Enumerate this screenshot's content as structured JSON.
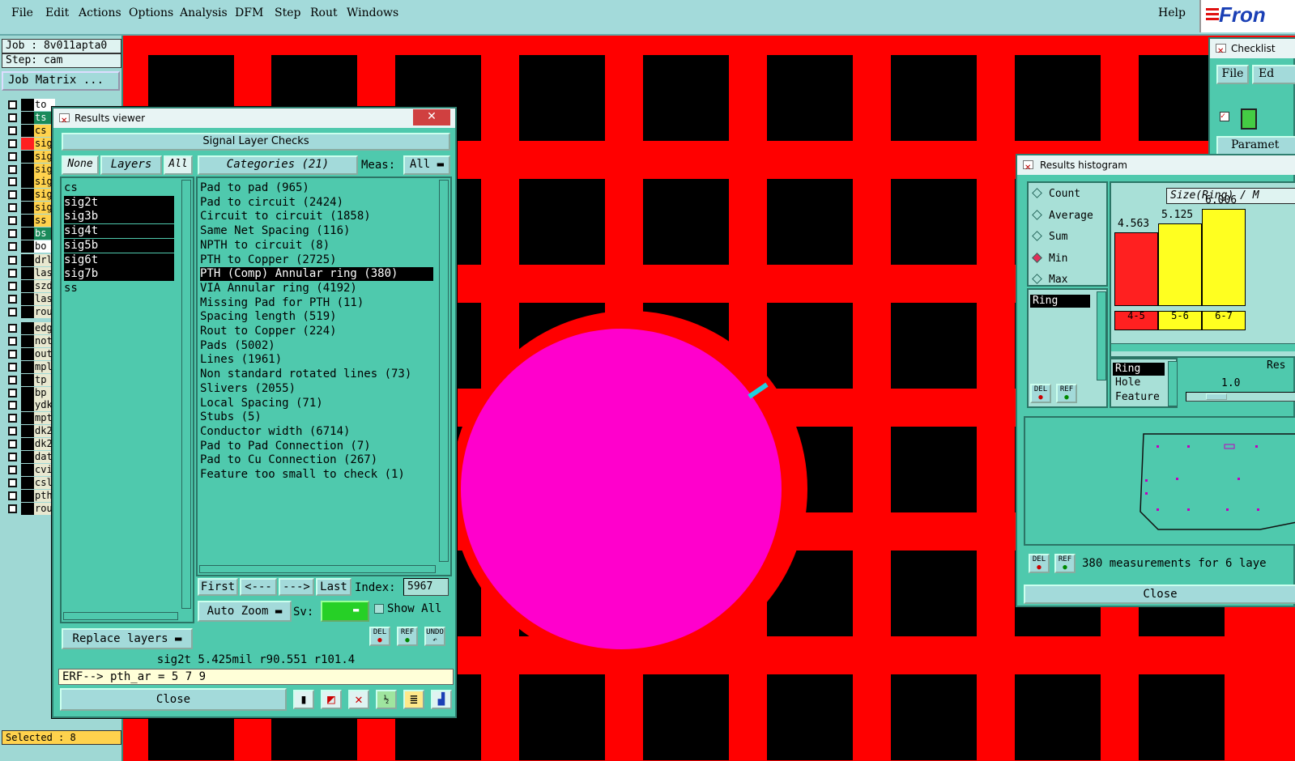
{
  "menubar": {
    "items": [
      "File",
      "Edit",
      "Actions",
      "Options",
      "Analysis",
      "DFM",
      "Step",
      "Rout",
      "Windows"
    ],
    "help": "Help",
    "logo": "Fron"
  },
  "left_panel": {
    "job": "Job : 8v011apta0",
    "step": "Step: cam",
    "job_matrix": "Job Matrix ...",
    "layers": [
      {
        "name": "to",
        "color": "#ffffff"
      },
      {
        "name": "ts",
        "color": "#1a8a5a"
      },
      {
        "name": "cs",
        "color": "#ffd24d"
      },
      {
        "name": "sig",
        "color": "#ffd24d"
      },
      {
        "name": "sig",
        "color": "#ffd24d"
      },
      {
        "name": "sig",
        "color": "#ffd24d"
      },
      {
        "name": "sig",
        "color": "#ffd24d"
      },
      {
        "name": "sig",
        "color": "#ffd24d"
      },
      {
        "name": "sig",
        "color": "#ffd24d"
      },
      {
        "name": "ss",
        "color": "#ffd24d"
      },
      {
        "name": "bs",
        "color": "#1a8a5a"
      },
      {
        "name": "bo",
        "color": "#ffffff"
      }
    ],
    "layers2": [
      {
        "name": "drl",
        "color": "#e8e8d0"
      },
      {
        "name": "las",
        "color": "#e8e8d0"
      },
      {
        "name": "szd",
        "color": "#e8e8d0"
      },
      {
        "name": "las",
        "color": "#e8e8d0"
      },
      {
        "name": "rou",
        "color": "#e8e8d0"
      }
    ],
    "layers3": [
      {
        "name": "edg",
        "color": "#e8e8d0"
      },
      {
        "name": "not",
        "color": "#e8e8d0"
      },
      {
        "name": "out",
        "color": "#e8e8d0"
      },
      {
        "name": "mpl",
        "color": "#e8e8d0"
      },
      {
        "name": "tp",
        "color": "#e8e8d0"
      },
      {
        "name": "bp",
        "color": "#e8e8d0"
      },
      {
        "name": "ydk",
        "color": "#e8e8d0"
      },
      {
        "name": "mpt",
        "color": "#e8e8d0"
      },
      {
        "name": "dk2",
        "color": "#e8e8d0"
      },
      {
        "name": "dk2",
        "color": "#e8e8d0"
      },
      {
        "name": "dat",
        "color": "#e8e8d0"
      },
      {
        "name": "cvi",
        "color": "#e8e8d0"
      },
      {
        "name": "csl",
        "color": "#e8e8d0"
      },
      {
        "name": "pth",
        "color": "#e8e8d0"
      },
      {
        "name": "rou",
        "color": "#e8e8d0"
      }
    ],
    "selected": "Selected : 8"
  },
  "results_viewer": {
    "title": "Results viewer",
    "close_x": "✕",
    "header": "Signal Layer Checks",
    "none_btn": "None",
    "layers_btn": "Layers",
    "all_btn": "All",
    "categories_btn": "Categories (21)",
    "meas_label": "Meas:",
    "meas_value": "All",
    "layer_list": [
      {
        "name": "cs",
        "selected": false
      },
      {
        "name": "sig2t",
        "selected": true
      },
      {
        "name": "sig3b",
        "selected": true
      },
      {
        "name": "sig4t",
        "selected": true
      },
      {
        "name": "sig5b",
        "selected": true
      },
      {
        "name": "sig6t",
        "selected": true
      },
      {
        "name": "sig7b",
        "selected": true
      },
      {
        "name": "ss",
        "selected": false
      }
    ],
    "categories": [
      {
        "name": "Pad to pad (965)",
        "selected": false
      },
      {
        "name": "Pad to circuit (2424)",
        "selected": false
      },
      {
        "name": "Circuit to circuit (1858)",
        "selected": false
      },
      {
        "name": "Same Net Spacing (116)",
        "selected": false
      },
      {
        "name": "NPTH to circuit (8)",
        "selected": false
      },
      {
        "name": "PTH to Copper (2725)",
        "selected": false
      },
      {
        "name": "PTH (Comp) Annular ring (380)",
        "selected": true
      },
      {
        "name": "VIA Annular ring (4192)",
        "selected": false
      },
      {
        "name": "Missing Pad for PTH (11)",
        "selected": false
      },
      {
        "name": "Spacing length (519)",
        "selected": false
      },
      {
        "name": "Rout to Copper (224)",
        "selected": false
      },
      {
        "name": "Pads (5002)",
        "selected": false
      },
      {
        "name": "Lines (1961)",
        "selected": false
      },
      {
        "name": "Non standard rotated lines (73)",
        "selected": false
      },
      {
        "name": "Slivers (2055)",
        "selected": false
      },
      {
        "name": "Local Spacing (71)",
        "selected": false
      },
      {
        "name": "Stubs (5)",
        "selected": false
      },
      {
        "name": "Conductor width (6714)",
        "selected": false
      },
      {
        "name": "Pad to Pad Connection (7)",
        "selected": false
      },
      {
        "name": "Pad to Cu Connection (267)",
        "selected": false
      },
      {
        "name": "Feature too small to check (1)",
        "selected": false
      }
    ],
    "nav": {
      "first": "First",
      "prev": "<---",
      "next": "--->",
      "last": "Last",
      "index_label": "Index:",
      "index_value": "5967"
    },
    "auto_zoom": "Auto Zoom",
    "sv_label": "Sv:",
    "show_all": "Show All",
    "replace_layers": "Replace layers",
    "del": "DEL",
    "ref": "REF",
    "undo": "UNDO",
    "status": "sig2t 5.425mil  r90.551  r101.4",
    "erf": "ERF--> pth_ar = 5 7 9",
    "close": "Close"
  },
  "histogram": {
    "title": "Results histogram",
    "modes": [
      {
        "label": "Count",
        "on": false
      },
      {
        "label": "Average",
        "on": false
      },
      {
        "label": "Sum",
        "on": false
      },
      {
        "label": "Min",
        "on": true
      },
      {
        "label": "Max",
        "on": false
      }
    ],
    "ring_item": "Ring",
    "chart_title": "Size(Ring) / M",
    "bars": [
      {
        "bin": "4-5",
        "value": 4.563,
        "label": "4.563",
        "color": "#ff2020"
      },
      {
        "bin": "5-6",
        "value": 5.125,
        "label": "5.125",
        "color": "#ffff20"
      },
      {
        "bin": "6-7",
        "value": 6.006,
        "label": "6.006",
        "color": "#ffff20"
      }
    ],
    "attrs": [
      "Ring",
      "Hole",
      "Feature"
    ],
    "res_label": "Res",
    "res_value": "1.0",
    "del": "DEL",
    "ref": "REF",
    "measurements": "380 measurements for 6 laye",
    "close": "Close"
  },
  "checklist": {
    "title": "Checklist",
    "file": "File",
    "edit": "Ed",
    "param": "Paramet"
  },
  "colors": {
    "copper": "#ff0000",
    "pad": "#ff00cc",
    "marker": "#20d0e0"
  }
}
